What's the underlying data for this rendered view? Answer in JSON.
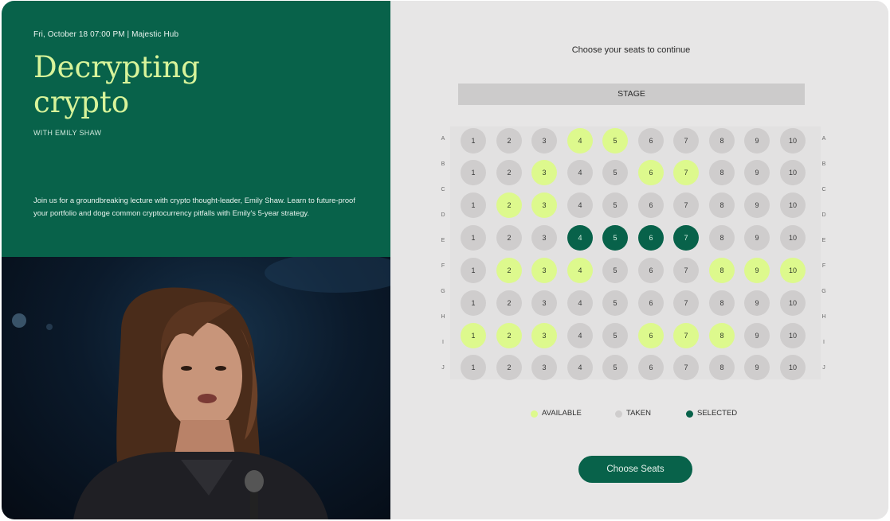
{
  "event": {
    "meta": "Fri, October 18 07:00 PM | Majestic Hub",
    "title_line1": "Decrypting",
    "title_line2": "crypto",
    "host": "WITH EMILY SHAW",
    "description": "Join us for a groundbreaking lecture with crypto thought-leader, Emily Shaw. Learn to future-proof your portfolio and doge common cryptocurrency pitfalls with Emily's 5-year strategy."
  },
  "seating": {
    "heading": "Choose your seats to continue",
    "stage_label": "STAGE",
    "rows": [
      {
        "label": "A",
        "seats": [
          "taken",
          "taken",
          "taken",
          "available",
          "available",
          "taken",
          "taken",
          "taken",
          "taken",
          "taken"
        ]
      },
      {
        "label": "B",
        "seats": [
          "taken",
          "taken",
          "available",
          "taken",
          "taken",
          "available",
          "available",
          "taken",
          "taken",
          "taken"
        ]
      },
      {
        "label": "C",
        "seats": [
          "taken",
          "available",
          "available",
          "taken",
          "taken",
          "taken",
          "taken",
          "taken",
          "taken",
          "taken"
        ]
      },
      {
        "label": "D",
        "seats": [
          "taken",
          "taken",
          "taken",
          "selected",
          "selected",
          "selected",
          "selected",
          "taken",
          "taken",
          "taken"
        ]
      },
      {
        "label": "E",
        "seats": [
          "taken",
          "available",
          "available",
          "available",
          "taken",
          "taken",
          "taken",
          "available",
          "available",
          "available"
        ]
      },
      {
        "label": "F",
        "seats": [
          "taken",
          "taken",
          "taken",
          "taken",
          "taken",
          "taken",
          "taken",
          "taken",
          "taken",
          "taken"
        ]
      },
      {
        "label": "G",
        "seats": [
          "available",
          "available",
          "available",
          "taken",
          "taken",
          "available",
          "available",
          "available",
          "taken",
          "taken"
        ]
      },
      {
        "label": "H",
        "seats": [
          "taken",
          "taken",
          "taken",
          "taken",
          "taken",
          "taken",
          "taken",
          "taken",
          "taken",
          "taken"
        ]
      }
    ],
    "left_labels": [
      "A",
      "B",
      "C",
      "D",
      "E",
      "F",
      "G",
      "H",
      "I",
      "J"
    ],
    "right_labels": [
      "A",
      "B",
      "C",
      "D",
      "E",
      "F",
      "G",
      "H",
      "I",
      "J"
    ],
    "seat_numbers": [
      "1",
      "2",
      "3",
      "4",
      "5",
      "6",
      "7",
      "8",
      "9",
      "10"
    ]
  },
  "legend": {
    "available": "AVAILABLE",
    "taken": "TAKEN",
    "selected": "SELECTED"
  },
  "colors": {
    "brand_green": "#08624a",
    "available": "#ddf98d",
    "taken": "#cfcdcd",
    "title_lime": "#d8f49a"
  },
  "cta": {
    "label": "Choose Seats"
  }
}
